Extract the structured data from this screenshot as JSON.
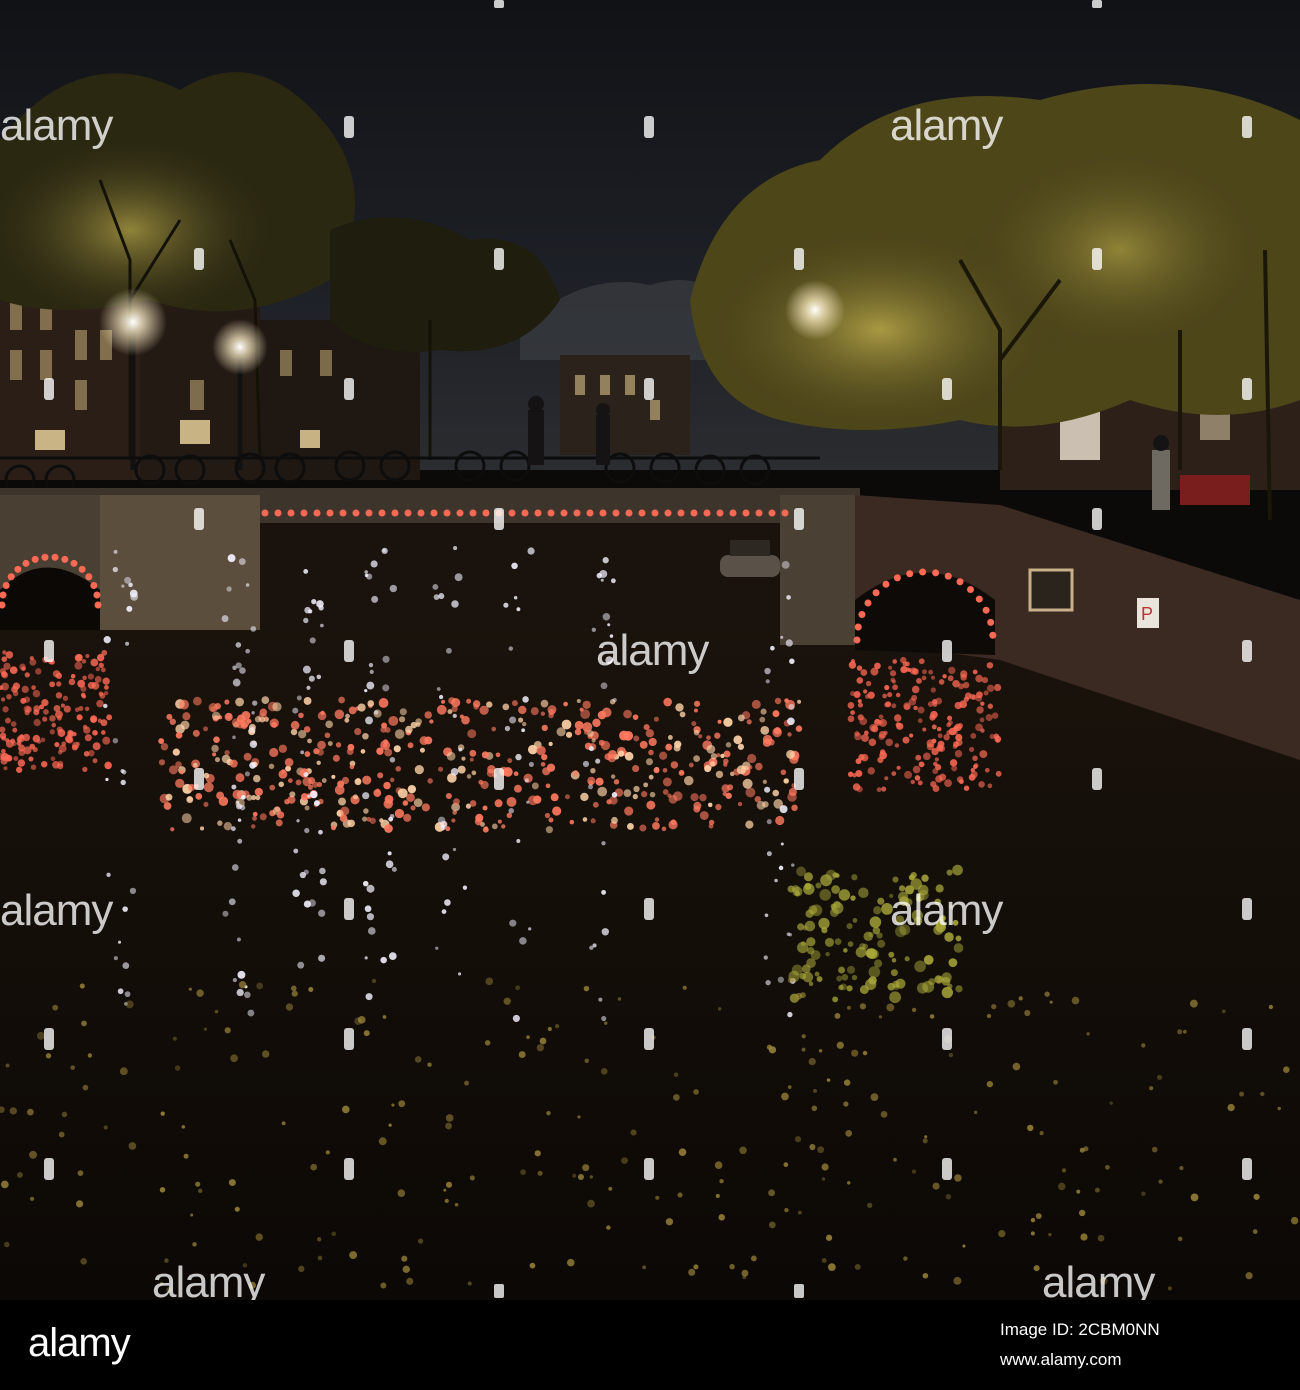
{
  "photo": {
    "watermark_text": "alamy",
    "colors": {
      "sky": "#16181d",
      "water": "#120d08",
      "foliage": "#8a7a2c",
      "bridge_light": "#ff6a55",
      "lamp_glow": "#fff3d6"
    }
  },
  "footer": {
    "logo_text": "alamy",
    "image_id": "Image ID: 2CBM0NN",
    "url": "www.alamy.com"
  },
  "colors": {
    "footer_background": "#000000",
    "footer_text": "#ffffff",
    "watermark": "#ffffff"
  }
}
